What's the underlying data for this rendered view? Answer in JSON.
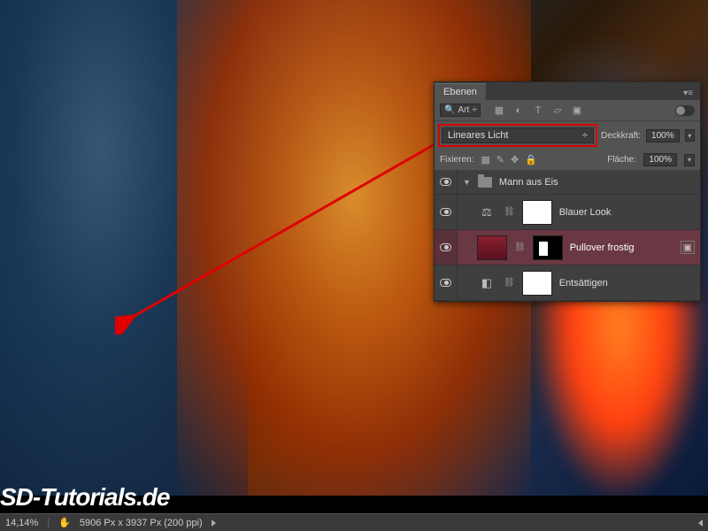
{
  "watermark": "SD-Tutorials.de",
  "status": {
    "zoom": "14,14%",
    "dimensions": "5906 Px x 3937 Px (200 ppi)"
  },
  "panel": {
    "title": "Ebenen",
    "filter_label": "Art",
    "opacity_label": "Deckkraft:",
    "opacity_value": "100%",
    "fill_label": "Fläche:",
    "fill_value": "100%",
    "lock_label": "Fixieren:",
    "blend_mode": "Lineares Licht"
  },
  "layers": {
    "group_name": "Mann aus Eis",
    "item1": "Blauer Look",
    "item2": "Pullover frostig",
    "item3": "Entsättigen"
  }
}
